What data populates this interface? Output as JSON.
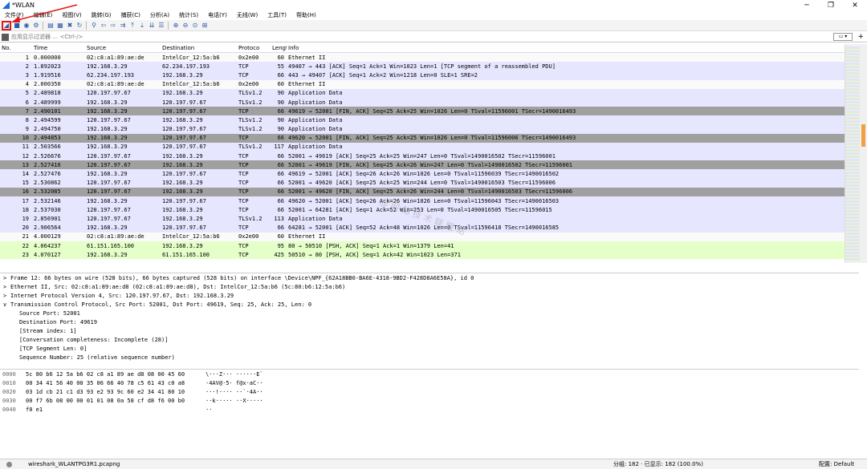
{
  "window": {
    "title": "*WLAN"
  },
  "menu": [
    "文件(F)",
    "编辑(E)",
    "视图(V)",
    "跳转(G)",
    "捕获(C)",
    "分析(A)",
    "统计(S)",
    "电话(Y)",
    "无线(W)",
    "工具(T)",
    "帮助(H)"
  ],
  "filter": {
    "placeholder": "应用显示过滤器 … <Ctrl-/>"
  },
  "columns": {
    "no": "No.",
    "time": "Time",
    "src": "Source",
    "dst": "Destination",
    "proto": "Protoco",
    "len": "Lengt",
    "info": "Info"
  },
  "packets": [
    {
      "no": "1",
      "time": "0.000000",
      "src": "02:c8:a1:89:ae:de",
      "dst": "IntelCor_12:5a:b6",
      "proto": "0x2e00",
      "len": "60",
      "info": "Ethernet II",
      "bg": "#fafafa"
    },
    {
      "no": "2",
      "time": "1.892023",
      "src": "192.168.3.29",
      "dst": "62.234.197.193",
      "proto": "TCP",
      "len": "55",
      "info": "49407 → 443 [ACK] Seq=1 Ack=1 Win=1023 Len=1 [TCP segment of a reassembled PDU]",
      "bg": "#e7e6ff"
    },
    {
      "no": "3",
      "time": "1.919516",
      "src": "62.234.197.193",
      "dst": "192.168.3.29",
      "proto": "TCP",
      "len": "66",
      "info": "443 → 49407 [ACK] Seq=1 Ack=2 Win=1218 Len=0 SLE=1 SRE=2",
      "bg": "#e7e6ff"
    },
    {
      "no": "4",
      "time": "2.000350",
      "src": "02:c8:a1:89:ae:de",
      "dst": "IntelCor_12:5a:b6",
      "proto": "0x2e00",
      "len": "60",
      "info": "Ethernet II",
      "bg": "#fafafa"
    },
    {
      "no": "5",
      "time": "2.489818",
      "src": "120.197.97.67",
      "dst": "192.168.3.29",
      "proto": "TLSv1.2",
      "len": "90",
      "info": "Application Data",
      "bg": "#e7e6ff"
    },
    {
      "no": "6",
      "time": "2.489999",
      "src": "192.168.3.29",
      "dst": "120.197.97.67",
      "proto": "TLSv1.2",
      "len": "90",
      "info": "Application Data",
      "bg": "#e7e6ff"
    },
    {
      "no": "7",
      "time": "2.490101",
      "src": "192.168.3.29",
      "dst": "120.197.97.67",
      "proto": "TCP",
      "len": "66",
      "info": "49619 → 52001 [FIN, ACK] Seq=25 Ack=25 Win=1026 Len=0 TSval=11596001 TSecr=1490016493",
      "bg": "#a0a0a0"
    },
    {
      "no": "8",
      "time": "2.494599",
      "src": "120.197.97.67",
      "dst": "192.168.3.29",
      "proto": "TLSv1.2",
      "len": "90",
      "info": "Application Data",
      "bg": "#e7e6ff"
    },
    {
      "no": "9",
      "time": "2.494750",
      "src": "192.168.3.29",
      "dst": "120.197.97.67",
      "proto": "TLSv1.2",
      "len": "90",
      "info": "Application Data",
      "bg": "#e7e6ff"
    },
    {
      "no": "10",
      "time": "2.494853",
      "src": "192.168.3.29",
      "dst": "120.197.97.67",
      "proto": "TCP",
      "len": "66",
      "info": "49620 → 52001 [FIN, ACK] Seq=25 Ack=25 Win=1026 Len=0 TSval=11596006 TSecr=1490016493",
      "bg": "#a0a0a0"
    },
    {
      "no": "11",
      "time": "2.503566",
      "src": "192.168.3.29",
      "dst": "120.197.97.67",
      "proto": "TLSv1.2",
      "len": "117",
      "info": "Application Data",
      "bg": "#e7e6ff"
    },
    {
      "no": "12",
      "time": "2.526676",
      "src": "120.197.97.67",
      "dst": "192.168.3.29",
      "proto": "TCP",
      "len": "66",
      "info": "52001 → 49619 [ACK] Seq=25 Ack=25 Win=247 Len=0 TSval=1490016502 TSecr=11596001",
      "bg": "#e7e6ff"
    },
    {
      "no": "13",
      "time": "2.527416",
      "src": "120.197.97.67",
      "dst": "192.168.3.29",
      "proto": "TCP",
      "len": "66",
      "info": "52001 → 49619 [FIN, ACK] Seq=25 Ack=26 Win=247 Len=0 TSval=1490016502 TSecr=11596001",
      "bg": "#a0a0a0"
    },
    {
      "no": "14",
      "time": "2.527476",
      "src": "192.168.3.29",
      "dst": "120.197.97.67",
      "proto": "TCP",
      "len": "66",
      "info": "49619 → 52001 [ACK] Seq=26 Ack=26 Win=1026 Len=0 TSval=11596039 TSecr=1490016502",
      "bg": "#e7e6ff"
    },
    {
      "no": "15",
      "time": "2.530862",
      "src": "120.197.97.67",
      "dst": "192.168.3.29",
      "proto": "TCP",
      "len": "66",
      "info": "52001 → 49620 [ACK] Seq=25 Ack=25 Win=244 Len=0 TSval=1490016503 TSecr=11596006",
      "bg": "#e7e6ff"
    },
    {
      "no": "16",
      "time": "2.532085",
      "src": "120.197.97.67",
      "dst": "192.168.3.29",
      "proto": "TCP",
      "len": "66",
      "info": "52001 → 49620 [FIN, ACK] Seq=25 Ack=26 Win=244 Len=0 TSval=1490016503 TSecr=11596006",
      "bg": "#a0a0a0"
    },
    {
      "no": "17",
      "time": "2.532146",
      "src": "192.168.3.29",
      "dst": "120.197.97.67",
      "proto": "TCP",
      "len": "66",
      "info": "49620 → 52001 [ACK] Seq=26 Ack=26 Win=1026 Len=0 TSval=11596043 TSecr=1490016503",
      "bg": "#e7e6ff"
    },
    {
      "no": "18",
      "time": "2.537030",
      "src": "120.197.97.67",
      "dst": "192.168.3.29",
      "proto": "TCP",
      "len": "66",
      "info": "52001 → 64281 [ACK] Seq=1 Ack=52 Win=253 Len=0 TSval=1490016505 TSecr=11596015",
      "bg": "#e7e6ff"
    },
    {
      "no": "19",
      "time": "2.856901",
      "src": "120.197.97.67",
      "dst": "192.168.3.29",
      "proto": "TLSv1.2",
      "len": "113",
      "info": "Application Data",
      "bg": "#e7e6ff"
    },
    {
      "no": "20",
      "time": "2.906564",
      "src": "192.168.3.29",
      "dst": "120.197.97.67",
      "proto": "TCP",
      "len": "66",
      "info": "64281 → 52001 [ACK] Seq=52 Ack=48 Win=1026 Len=0 TSval=11596418 TSecr=1490016585",
      "bg": "#e7e6ff"
    },
    {
      "no": "21",
      "time": "4.000129",
      "src": "02:c8:a1:89:ae:de",
      "dst": "IntelCor_12:5a:b6",
      "proto": "0x2e00",
      "len": "60",
      "info": "Ethernet II",
      "bg": "#fafafa"
    },
    {
      "no": "22",
      "time": "4.064237",
      "src": "61.151.165.100",
      "dst": "192.168.3.29",
      "proto": "TCP",
      "len": "95",
      "info": "80 → 50510 [PSH, ACK] Seq=1 Ack=1 Win=1379 Len=41",
      "bg": "#e4ffc7"
    },
    {
      "no": "23",
      "time": "4.070127",
      "src": "192.168.3.29",
      "dst": "61.151.165.100",
      "proto": "TCP",
      "len": "425",
      "info": "50510 → 80 [PSH, ACK] Seq=1 Ack=42 Win=1023 Len=371",
      "bg": "#e4ffc7"
    }
  ],
  "details": [
    {
      "text": "Frame 12: 66 bytes on wire (528 bits), 66 bytes captured (528 bits) on interface \\Device\\NPF_{62A18BB0-BA6E-4318-9BD2-F428D8A6E58A}, id 0",
      "indent": 0,
      "arrow": ">"
    },
    {
      "text": "Ethernet II, Src: 02:c8:a1:89:ae:d8 (02:c8:a1:89:ae:d8), Dst: IntelCor_12:5a:b6 (5c:80:b6:12:5a:b6)",
      "indent": 0,
      "arrow": ">"
    },
    {
      "text": "Internet Protocol Version 4, Src: 120.197.97.67, Dst: 192.168.3.29",
      "indent": 0,
      "arrow": ">"
    },
    {
      "text": "Transmission Control Protocol, Src Port: 52001, Dst Port: 49619, Seq: 25, Ack: 25, Len: 0",
      "indent": 0,
      "arrow": "v"
    },
    {
      "text": "Source Port: 52001",
      "indent": 1,
      "arrow": ""
    },
    {
      "text": "Destination Port: 49619",
      "indent": 1,
      "arrow": ""
    },
    {
      "text": "[Stream index: 1]",
      "indent": 1,
      "arrow": ""
    },
    {
      "text": "[Conversation completeness: Incomplete (28)]",
      "indent": 1,
      "arrow": ""
    },
    {
      "text": "[TCP Segment Len: 0]",
      "indent": 1,
      "arrow": ""
    },
    {
      "text": "Sequence Number: 25    (relative sequence number)",
      "indent": 1,
      "arrow": ""
    }
  ],
  "hexdump": [
    {
      "off": "0000",
      "bytes": "5c 80 b6 12 5a b6 02 c8  a1 89 ae d8 08 00 45 60",
      "ascii": "\\···Z··· ······E`"
    },
    {
      "off": "0010",
      "bytes": "00 34 41 56 40 00 35 06  66 40 78 c5 61 43 c0 a8",
      "ascii": "·4AV@·5· f@x·aC··"
    },
    {
      "off": "0020",
      "bytes": "03 1d cb 21 c1 d3 93 e2  93 9c 60 e2 34 41 80 10",
      "ascii": "···!···· ··`·4A··"
    },
    {
      "off": "0030",
      "bytes": "00 f7 6b 08 00 00 01 01  08 0a 58 cf d8 f6 00 b0",
      "ascii": "··k····· ··X·····"
    },
    {
      "off": "0040",
      "bytes": "f0 e1",
      "ascii": "··"
    }
  ],
  "status": {
    "file": "wireshark_WLANTPG3R1.pcapng",
    "stats": "分组: 182 · 已显示: 182 (100.0%)",
    "profile": "配置: Default"
  },
  "watermark": "@ 网 络 技 术 联 盟 站",
  "colors": {
    "selected_border": "#e01a1a",
    "tcp": "#e7e6ff",
    "fin": "#a0a0a0",
    "http": "#e4ffc7"
  }
}
